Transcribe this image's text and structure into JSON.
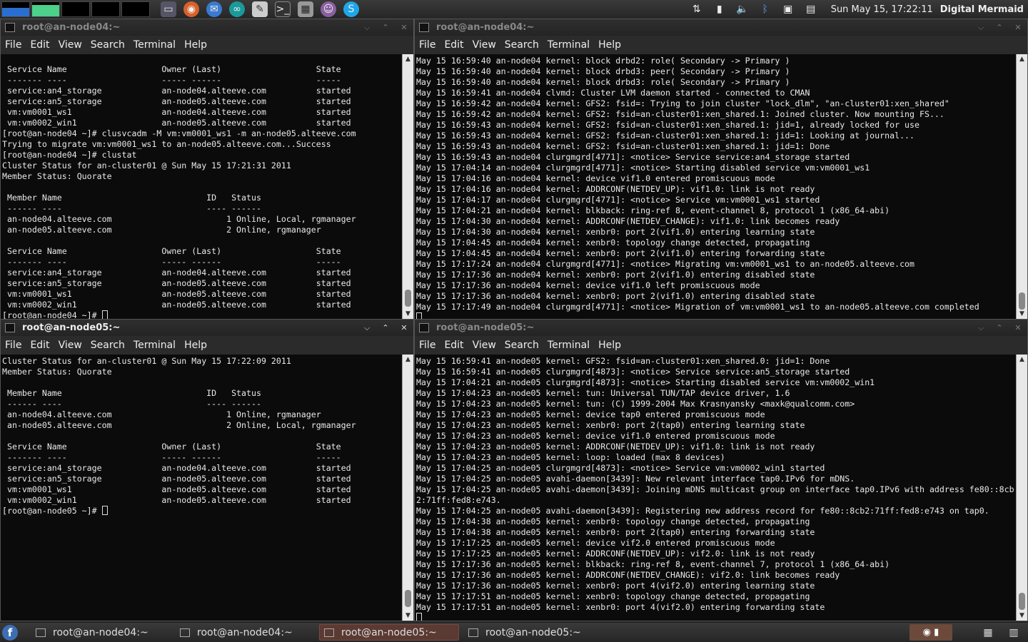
{
  "top_panel": {
    "clock": "Sun May 15, 17:22:11",
    "username": "Digital Mermaid",
    "launchers": [
      "firefox-icon",
      "thunderbird-icon",
      "arduino-icon",
      "text-editor-icon",
      "terminal-icon",
      "calculator-icon",
      "pidgin-icon",
      "skype-icon"
    ],
    "tray": [
      "network-icon",
      "battery-icon",
      "volume-icon",
      "bluetooth-icon",
      "display-icon",
      "clipboard-icon"
    ]
  },
  "menu": [
    "File",
    "Edit",
    "View",
    "Search",
    "Terminal",
    "Help"
  ],
  "windows": [
    {
      "title": "root@an-node04:~",
      "lines": [
        " Service Name                   Owner (Last)                   State",
        " ------- ----                   ----- ------                   -----",
        " service:an4_storage            an-node04.alteeve.com          started",
        " service:an5_storage            an-node05.alteeve.com          started",
        " vm:vm0001_ws1                  an-node04.alteeve.com          started",
        " vm:vm0002_win1                 an-node05.alteeve.com          started",
        "[root@an-node04 ~]# clusvcadm -M vm:vm0001_ws1 -m an-node05.alteeve.com",
        "Trying to migrate vm:vm0001_ws1 to an-node05.alteeve.com...Success",
        "[root@an-node04 ~]# clustat",
        "Cluster Status for an-cluster01 @ Sun May 15 17:21:31 2011",
        "Member Status: Quorate",
        "",
        " Member Name                             ID   Status",
        " ------ ----                             ---- ------",
        " an-node04.alteeve.com                       1 Online, Local, rgmanager",
        " an-node05.alteeve.com                       2 Online, rgmanager",
        "",
        " Service Name                   Owner (Last)                   State",
        " ------- ----                   ----- ------                   -----",
        " service:an4_storage            an-node04.alteeve.com          started",
        " service:an5_storage            an-node05.alteeve.com          started",
        " vm:vm0001_ws1                  an-node05.alteeve.com          started",
        " vm:vm0002_win1                 an-node05.alteeve.com          started"
      ],
      "prompt": "[root@an-node04 ~]# "
    },
    {
      "title": "root@an-node04:~",
      "lines": [
        "May 15 16:59:40 an-node04 kernel: block drbd2: role( Secondary -> Primary )",
        "May 15 16:59:40 an-node04 kernel: block drbd3: peer( Secondary -> Primary )",
        "May 15 16:59:40 an-node04 kernel: block drbd3: role( Secondary -> Primary )",
        "May 15 16:59:41 an-node04 clvmd: Cluster LVM daemon started - connected to CMAN",
        "May 15 16:59:42 an-node04 kernel: GFS2: fsid=: Trying to join cluster \"lock_dlm\", \"an-cluster01:xen_shared\"",
        "May 15 16:59:42 an-node04 kernel: GFS2: fsid=an-cluster01:xen_shared.1: Joined cluster. Now mounting FS...",
        "May 15 16:59:43 an-node04 kernel: GFS2: fsid=an-cluster01:xen_shared.1: jid=1, already locked for use",
        "May 15 16:59:43 an-node04 kernel: GFS2: fsid=an-cluster01:xen_shared.1: jid=1: Looking at journal...",
        "May 15 16:59:43 an-node04 kernel: GFS2: fsid=an-cluster01:xen_shared.1: jid=1: Done",
        "May 15 16:59:43 an-node04 clurgmgrd[4771]: <notice> Service service:an4_storage started",
        "May 15 17:04:14 an-node04 clurgmgrd[4771]: <notice> Starting disabled service vm:vm0001_ws1",
        "May 15 17:04:16 an-node04 kernel: device vif1.0 entered promiscuous mode",
        "May 15 17:04:16 an-node04 kernel: ADDRCONF(NETDEV_UP): vif1.0: link is not ready",
        "May 15 17:04:17 an-node04 clurgmgrd[4771]: <notice> Service vm:vm0001_ws1 started",
        "May 15 17:04:21 an-node04 kernel: blkback: ring-ref 8, event-channel 8, protocol 1 (x86_64-abi)",
        "May 15 17:04:30 an-node04 kernel: ADDRCONF(NETDEV_CHANGE): vif1.0: link becomes ready",
        "May 15 17:04:30 an-node04 kernel: xenbr0: port 2(vif1.0) entering learning state",
        "May 15 17:04:45 an-node04 kernel: xenbr0: topology change detected, propagating",
        "May 15 17:04:45 an-node04 kernel: xenbr0: port 2(vif1.0) entering forwarding state",
        "May 15 17:17:24 an-node04 clurgmgrd[4771]: <notice> Migrating vm:vm0001_ws1 to an-node05.alteeve.com",
        "May 15 17:17:36 an-node04 kernel: xenbr0: port 2(vif1.0) entering disabled state",
        "May 15 17:17:36 an-node04 kernel: device vif1.0 left promiscuous mode",
        "May 15 17:17:36 an-node04 kernel: xenbr0: port 2(vif1.0) entering disabled state",
        "May 15 17:17:49 an-node04 clurgmgrd[4771]: <notice> Migration of vm:vm0001_ws1 to an-node05.alteeve.com completed"
      ],
      "prompt": ""
    },
    {
      "title": "root@an-node05:~",
      "lines": [
        "Cluster Status for an-cluster01 @ Sun May 15 17:22:09 2011",
        "Member Status: Quorate",
        "",
        " Member Name                             ID   Status",
        " ------ ----                             ---- ------",
        " an-node04.alteeve.com                       1 Online, rgmanager",
        " an-node05.alteeve.com                       2 Online, Local, rgmanager",
        "",
        " Service Name                   Owner (Last)                   State",
        " ------- ----                   ----- ------                   -----",
        " service:an4_storage            an-node04.alteeve.com          started",
        " service:an5_storage            an-node05.alteeve.com          started",
        " vm:vm0001_ws1                  an-node05.alteeve.com          started",
        " vm:vm0002_win1                 an-node05.alteeve.com          started"
      ],
      "prompt": "[root@an-node05 ~]# "
    },
    {
      "title": "root@an-node05:~",
      "lines": [
        "May 15 16:59:41 an-node05 kernel: GFS2: fsid=an-cluster01:xen_shared.0: jid=1: Done",
        "May 15 16:59:41 an-node05 clurgmgrd[4873]: <notice> Service service:an5_storage started",
        "May 15 17:04:21 an-node05 clurgmgrd[4873]: <notice> Starting disabled service vm:vm0002_win1",
        "May 15 17:04:23 an-node05 kernel: tun: Universal TUN/TAP device driver, 1.6",
        "May 15 17:04:23 an-node05 kernel: tun: (C) 1999-2004 Max Krasnyansky <maxk@qualcomm.com>",
        "May 15 17:04:23 an-node05 kernel: device tap0 entered promiscuous mode",
        "May 15 17:04:23 an-node05 kernel: xenbr0: port 2(tap0) entering learning state",
        "May 15 17:04:23 an-node05 kernel: device vif1.0 entered promiscuous mode",
        "May 15 17:04:23 an-node05 kernel: ADDRCONF(NETDEV_UP): vif1.0: link is not ready",
        "May 15 17:04:23 an-node05 kernel: loop: loaded (max 8 devices)",
        "May 15 17:04:25 an-node05 clurgmgrd[4873]: <notice> Service vm:vm0002_win1 started",
        "May 15 17:04:25 an-node05 avahi-daemon[3439]: New relevant interface tap0.IPv6 for mDNS.",
        "May 15 17:04:25 an-node05 avahi-daemon[3439]: Joining mDNS multicast group on interface tap0.IPv6 with address fe80::8cb",
        "2:71ff:fed8:e743.",
        "May 15 17:04:25 an-node05 avahi-daemon[3439]: Registering new address record for fe80::8cb2:71ff:fed8:e743 on tap0.",
        "May 15 17:04:38 an-node05 kernel: xenbr0: topology change detected, propagating",
        "May 15 17:04:38 an-node05 kernel: xenbr0: port 2(tap0) entering forwarding state",
        "May 15 17:17:25 an-node05 kernel: device vif2.0 entered promiscuous mode",
        "May 15 17:17:25 an-node05 kernel: ADDRCONF(NETDEV_UP): vif2.0: link is not ready",
        "May 15 17:17:36 an-node05 kernel: blkback: ring-ref 8, event-channel 7, protocol 1 (x86_64-abi)",
        "May 15 17:17:36 an-node05 kernel: ADDRCONF(NETDEV_CHANGE): vif2.0: link becomes ready",
        "May 15 17:17:36 an-node05 kernel: xenbr0: port 4(vif2.0) entering learning state",
        "May 15 17:17:51 an-node05 kernel: xenbr0: topology change detected, propagating",
        "May 15 17:17:51 an-node05 kernel: xenbr0: port 4(vif2.0) entering forwarding state"
      ],
      "prompt": ""
    }
  ],
  "taskbar": [
    {
      "label": "root@an-node04:~",
      "active": false
    },
    {
      "label": "root@an-node04:~",
      "active": false
    },
    {
      "label": "root@an-node05:~",
      "active": true
    },
    {
      "label": "root@an-node05:~",
      "active": false
    }
  ],
  "colors": {
    "terminal_bg": "#0b0b0b",
    "terminal_fg": "#e8e8e8",
    "active_task": "#5a3a32"
  }
}
